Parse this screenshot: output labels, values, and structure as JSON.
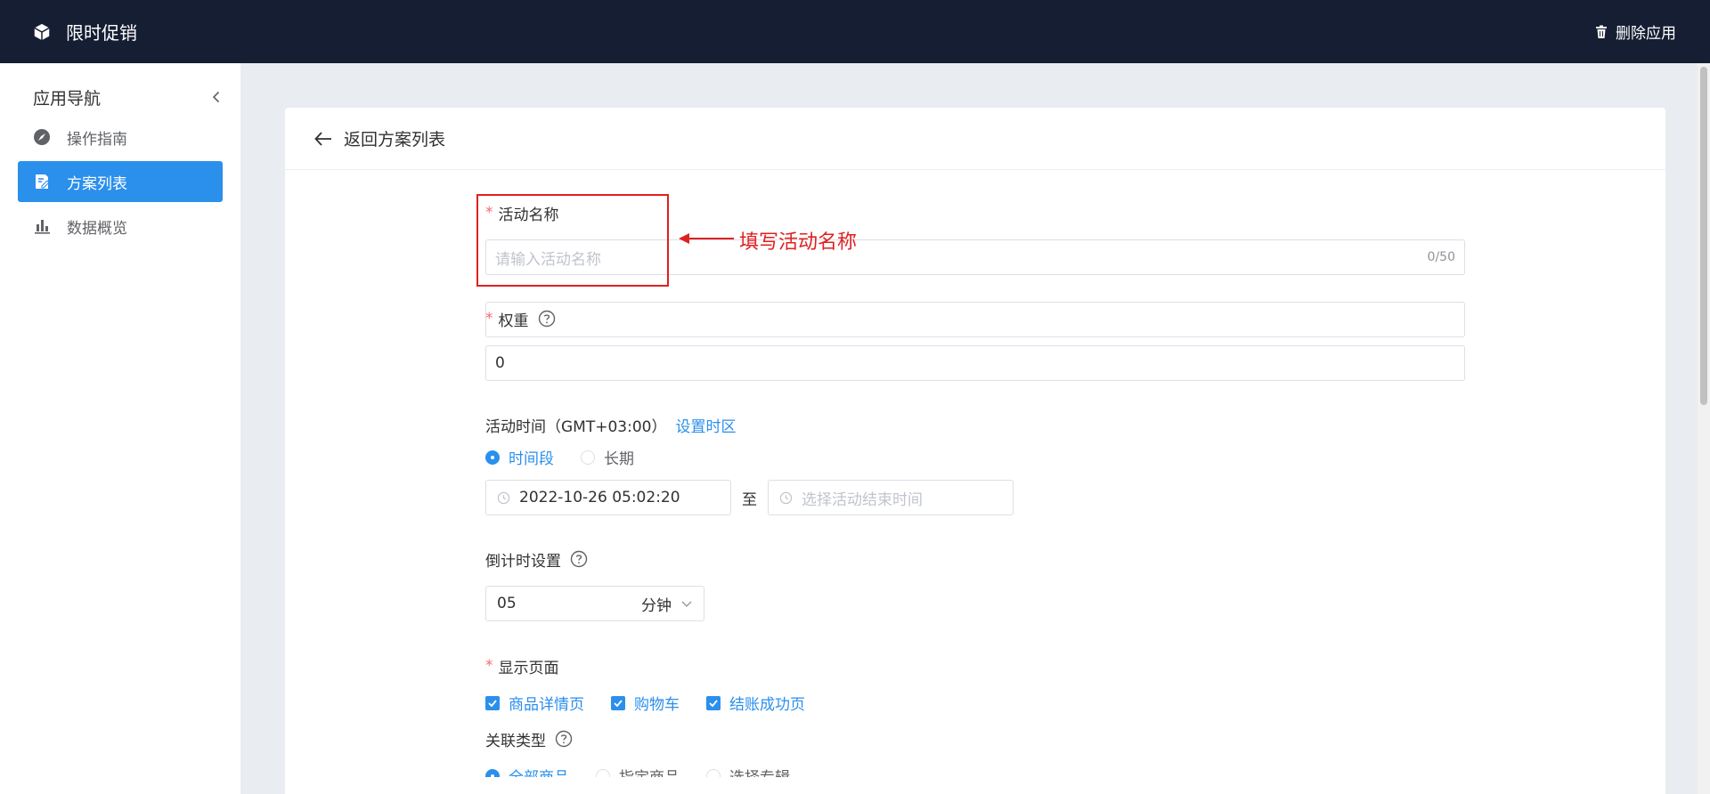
{
  "header": {
    "app_title": "限时促销",
    "delete_label": "删除应用"
  },
  "sidebar": {
    "title": "应用导航",
    "items": [
      {
        "label": "操作指南",
        "icon": "compass-icon",
        "active": false
      },
      {
        "label": "方案列表",
        "icon": "edit-icon",
        "active": true
      },
      {
        "label": "数据概览",
        "icon": "bar-chart-icon",
        "active": false
      }
    ]
  },
  "card": {
    "back_label": "返回方案列表"
  },
  "form": {
    "name": {
      "label": "活动名称",
      "placeholder": "请输入活动名称",
      "count": "0/50"
    },
    "weight": {
      "label": "权重",
      "value": "0"
    },
    "time": {
      "label": "活动时间（GMT+03:00）",
      "tz_link": "设置时区",
      "options": [
        "时间段",
        "长期"
      ],
      "start_value": "2022-10-26 05:02:20",
      "separator": "至",
      "end_placeholder": "选择活动结束时间"
    },
    "countdown": {
      "label": "倒计时设置",
      "value": "05",
      "unit": "分钟"
    },
    "pages": {
      "label": "显示页面",
      "options": [
        "商品详情页",
        "购物车",
        "结账成功页"
      ]
    },
    "relation": {
      "label": "关联类型",
      "options": [
        "全部商品",
        "指定商品",
        "选择专辑"
      ]
    }
  },
  "annotation": {
    "text": "填写活动名称",
    "color": "#e02020"
  },
  "colors": {
    "topbar": "#151e33",
    "accent": "#2b8fec",
    "required": "#f56c6c"
  }
}
